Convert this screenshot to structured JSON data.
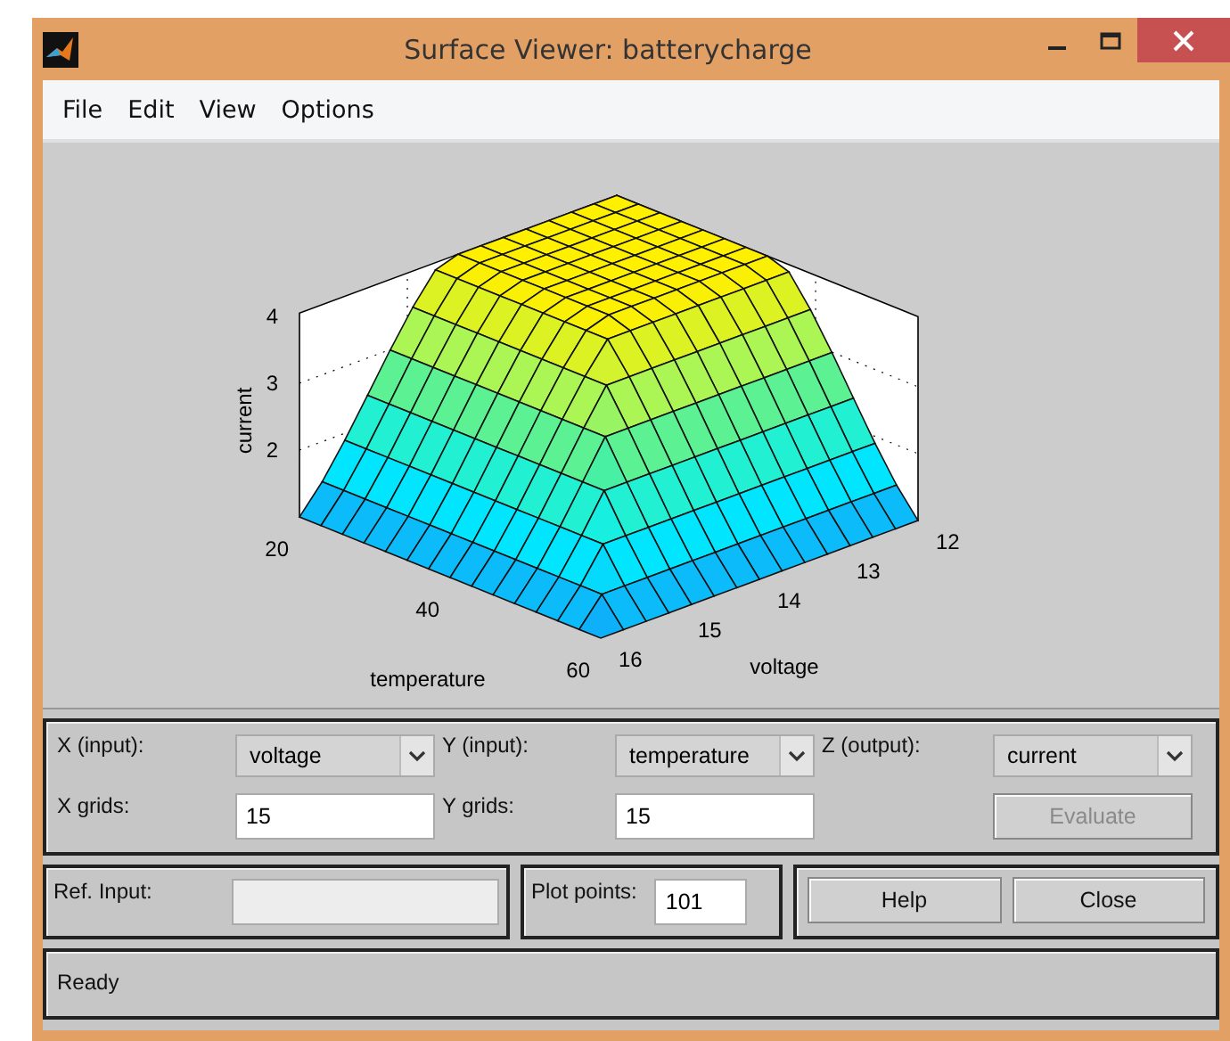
{
  "window": {
    "title": "Surface Viewer: batterycharge"
  },
  "menu": [
    "File",
    "Edit",
    "View",
    "Options"
  ],
  "plot": {
    "zlabel": "current",
    "xlabel": "voltage",
    "ylabel": "temperature",
    "z_ticks": [
      "4",
      "3",
      "2"
    ],
    "x_ticks": [
      "12",
      "13",
      "14",
      "15",
      "16"
    ],
    "y_ticks": [
      "20",
      "40",
      "60"
    ]
  },
  "axes": [
    {
      "label": "X (input):",
      "value": "voltage"
    },
    {
      "label": "Y (input):",
      "value": "temperature"
    },
    {
      "label": "Z (output):",
      "value": "current"
    }
  ],
  "grids": [
    {
      "label": "X grids:",
      "value": "15"
    },
    {
      "label": "Y grids:",
      "value": "15"
    }
  ],
  "evaluate": {
    "label": "Evaluate",
    "disabled": true
  },
  "ref_input": {
    "label": "Ref. Input:",
    "disabled": true
  },
  "plot_points": {
    "label": "Plot points:",
    "value": "101"
  },
  "buttons": [
    "Help",
    "Close"
  ],
  "status": "Ready"
}
